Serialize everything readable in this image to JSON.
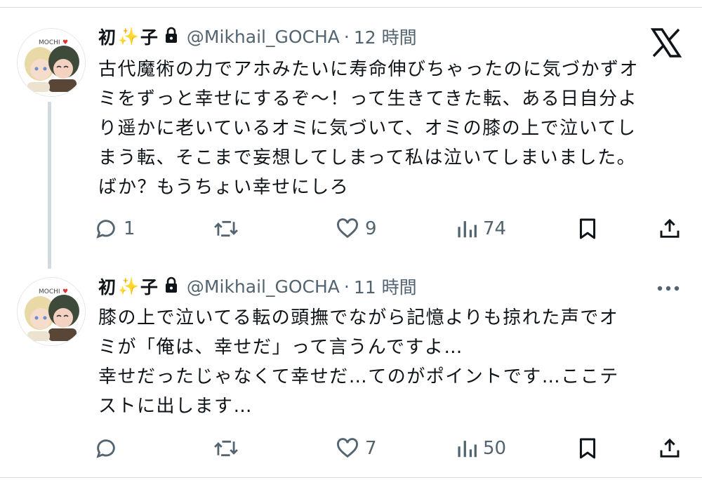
{
  "tweets": [
    {
      "name_a": "初",
      "sparkle": "✨",
      "name_b": "子",
      "handle": "@Mikhail_GOCHA",
      "dot": "·",
      "time": "12 時間",
      "text": "古代魔術の力でアホみたいに寿命伸びちゃったのに気づかずオ\nミをずっと幸せにするぞ〜！って生きてきた転、ある日自分よ\nり遥かに老いているオミに気づいて、オミの膝の上で泣いてし\nまう転、そこまで妄想してしまって私は泣いてしまいました。\nばか？もうちょい幸せにしろ",
      "replies": "1",
      "retweets": "",
      "likes": "9",
      "views": "74",
      "avatar_text": "MOCHI"
    },
    {
      "name_a": "初",
      "sparkle": "✨",
      "name_b": "子",
      "handle": "@Mikhail_GOCHA",
      "dot": "·",
      "time": "11 時間",
      "text": "膝の上で泣いてる転の頭撫でながら記憶よりも掠れた声でオ\nミが「俺は、幸せだ」って言うんですよ…\n幸せだったじゃなくて幸せだ…てのがポイントです…ここテ\nストに出します…",
      "replies": "",
      "retweets": "",
      "likes": "7",
      "views": "50",
      "avatar_text": "MOCHI"
    }
  ],
  "icons": {
    "logo": "x-logo-icon",
    "more": "more-dots-icon",
    "lock": "lock-icon",
    "reply": "reply-icon",
    "retweet": "retweet-icon",
    "like": "heart-icon",
    "views": "views-chart-icon",
    "bookmark": "bookmark-icon",
    "share": "share-icon"
  },
  "colors": {
    "text": "#0f1419",
    "secondary": "#536471",
    "thread": "#cfd9de",
    "sparkle": "#f5c400"
  }
}
